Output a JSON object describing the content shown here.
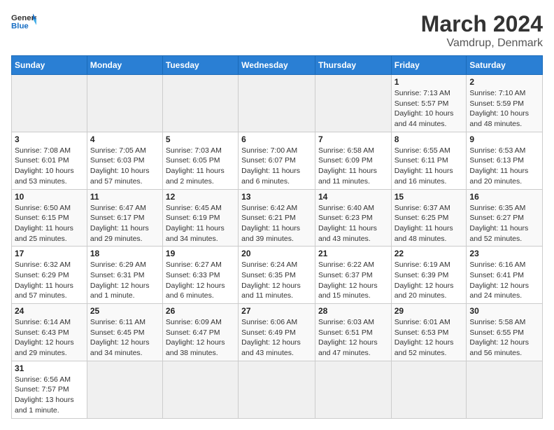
{
  "header": {
    "logo_general": "General",
    "logo_blue": "Blue",
    "title": "March 2024",
    "subtitle": "Vamdrup, Denmark"
  },
  "weekdays": [
    "Sunday",
    "Monday",
    "Tuesday",
    "Wednesday",
    "Thursday",
    "Friday",
    "Saturday"
  ],
  "days": [
    {
      "date": "",
      "info": ""
    },
    {
      "date": "",
      "info": ""
    },
    {
      "date": "",
      "info": ""
    },
    {
      "date": "",
      "info": ""
    },
    {
      "date": "",
      "info": ""
    },
    {
      "date": "1",
      "info": "Sunrise: 7:13 AM\nSunset: 5:57 PM\nDaylight: 10 hours\nand 44 minutes."
    },
    {
      "date": "2",
      "info": "Sunrise: 7:10 AM\nSunset: 5:59 PM\nDaylight: 10 hours\nand 48 minutes."
    },
    {
      "date": "3",
      "info": "Sunrise: 7:08 AM\nSunset: 6:01 PM\nDaylight: 10 hours\nand 53 minutes."
    },
    {
      "date": "4",
      "info": "Sunrise: 7:05 AM\nSunset: 6:03 PM\nDaylight: 10 hours\nand 57 minutes."
    },
    {
      "date": "5",
      "info": "Sunrise: 7:03 AM\nSunset: 6:05 PM\nDaylight: 11 hours\nand 2 minutes."
    },
    {
      "date": "6",
      "info": "Sunrise: 7:00 AM\nSunset: 6:07 PM\nDaylight: 11 hours\nand 6 minutes."
    },
    {
      "date": "7",
      "info": "Sunrise: 6:58 AM\nSunset: 6:09 PM\nDaylight: 11 hours\nand 11 minutes."
    },
    {
      "date": "8",
      "info": "Sunrise: 6:55 AM\nSunset: 6:11 PM\nDaylight: 11 hours\nand 16 minutes."
    },
    {
      "date": "9",
      "info": "Sunrise: 6:53 AM\nSunset: 6:13 PM\nDaylight: 11 hours\nand 20 minutes."
    },
    {
      "date": "10",
      "info": "Sunrise: 6:50 AM\nSunset: 6:15 PM\nDaylight: 11 hours\nand 25 minutes."
    },
    {
      "date": "11",
      "info": "Sunrise: 6:47 AM\nSunset: 6:17 PM\nDaylight: 11 hours\nand 29 minutes."
    },
    {
      "date": "12",
      "info": "Sunrise: 6:45 AM\nSunset: 6:19 PM\nDaylight: 11 hours\nand 34 minutes."
    },
    {
      "date": "13",
      "info": "Sunrise: 6:42 AM\nSunset: 6:21 PM\nDaylight: 11 hours\nand 39 minutes."
    },
    {
      "date": "14",
      "info": "Sunrise: 6:40 AM\nSunset: 6:23 PM\nDaylight: 11 hours\nand 43 minutes."
    },
    {
      "date": "15",
      "info": "Sunrise: 6:37 AM\nSunset: 6:25 PM\nDaylight: 11 hours\nand 48 minutes."
    },
    {
      "date": "16",
      "info": "Sunrise: 6:35 AM\nSunset: 6:27 PM\nDaylight: 11 hours\nand 52 minutes."
    },
    {
      "date": "17",
      "info": "Sunrise: 6:32 AM\nSunset: 6:29 PM\nDaylight: 11 hours\nand 57 minutes."
    },
    {
      "date": "18",
      "info": "Sunrise: 6:29 AM\nSunset: 6:31 PM\nDaylight: 12 hours\nand 1 minute."
    },
    {
      "date": "19",
      "info": "Sunrise: 6:27 AM\nSunset: 6:33 PM\nDaylight: 12 hours\nand 6 minutes."
    },
    {
      "date": "20",
      "info": "Sunrise: 6:24 AM\nSunset: 6:35 PM\nDaylight: 12 hours\nand 11 minutes."
    },
    {
      "date": "21",
      "info": "Sunrise: 6:22 AM\nSunset: 6:37 PM\nDaylight: 12 hours\nand 15 minutes."
    },
    {
      "date": "22",
      "info": "Sunrise: 6:19 AM\nSunset: 6:39 PM\nDaylight: 12 hours\nand 20 minutes."
    },
    {
      "date": "23",
      "info": "Sunrise: 6:16 AM\nSunset: 6:41 PM\nDaylight: 12 hours\nand 24 minutes."
    },
    {
      "date": "24",
      "info": "Sunrise: 6:14 AM\nSunset: 6:43 PM\nDaylight: 12 hours\nand 29 minutes."
    },
    {
      "date": "25",
      "info": "Sunrise: 6:11 AM\nSunset: 6:45 PM\nDaylight: 12 hours\nand 34 minutes."
    },
    {
      "date": "26",
      "info": "Sunrise: 6:09 AM\nSunset: 6:47 PM\nDaylight: 12 hours\nand 38 minutes."
    },
    {
      "date": "27",
      "info": "Sunrise: 6:06 AM\nSunset: 6:49 PM\nDaylight: 12 hours\nand 43 minutes."
    },
    {
      "date": "28",
      "info": "Sunrise: 6:03 AM\nSunset: 6:51 PM\nDaylight: 12 hours\nand 47 minutes."
    },
    {
      "date": "29",
      "info": "Sunrise: 6:01 AM\nSunset: 6:53 PM\nDaylight: 12 hours\nand 52 minutes."
    },
    {
      "date": "30",
      "info": "Sunrise: 5:58 AM\nSunset: 6:55 PM\nDaylight: 12 hours\nand 56 minutes."
    },
    {
      "date": "31",
      "info": "Sunrise: 6:56 AM\nSunset: 7:57 PM\nDaylight: 13 hours\nand 1 minute."
    },
    {
      "date": "",
      "info": ""
    },
    {
      "date": "",
      "info": ""
    },
    {
      "date": "",
      "info": ""
    },
    {
      "date": "",
      "info": ""
    },
    {
      "date": "",
      "info": ""
    },
    {
      "date": "",
      "info": ""
    }
  ]
}
